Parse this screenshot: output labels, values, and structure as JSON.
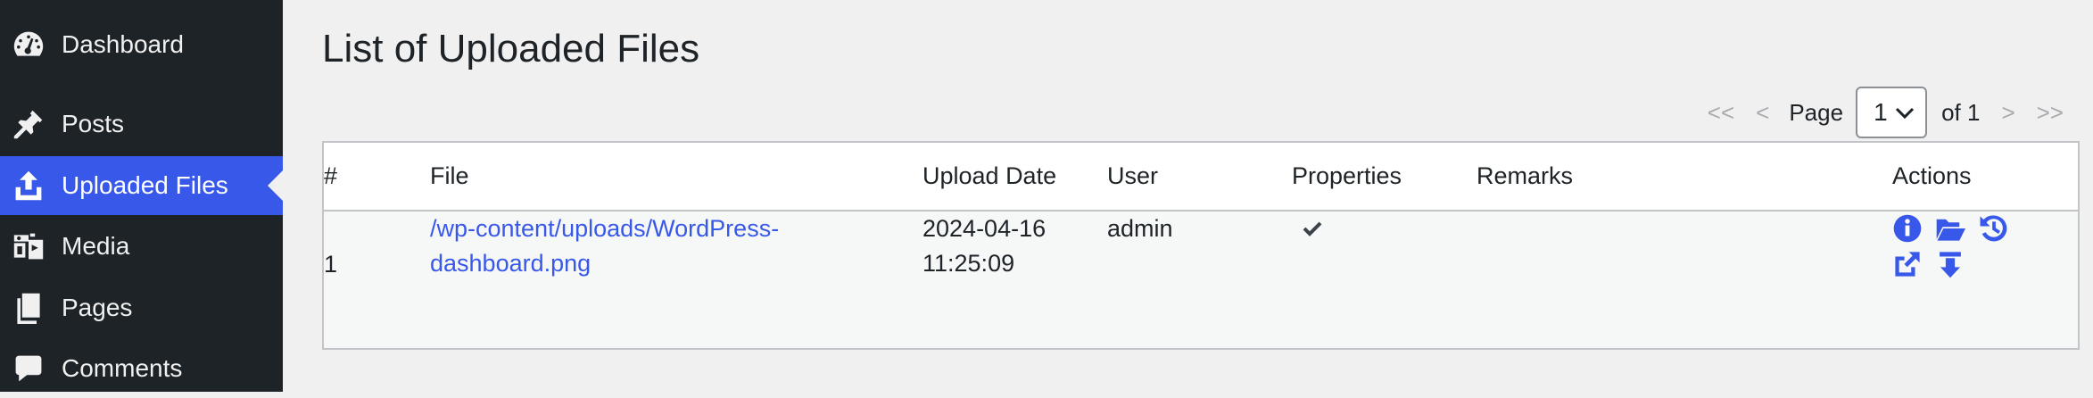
{
  "sidebar": {
    "items": [
      {
        "label": "Dashboard",
        "icon": "dashboard-icon"
      },
      {
        "label": "Posts",
        "icon": "pin-icon"
      },
      {
        "label": "Uploaded Files",
        "icon": "upload-icon",
        "active": true
      },
      {
        "label": "Media",
        "icon": "media-icon"
      },
      {
        "label": "Pages",
        "icon": "pages-icon"
      },
      {
        "label": "Comments",
        "icon": "comment-icon"
      }
    ]
  },
  "main": {
    "title": "List of Uploaded Files",
    "pagination": {
      "first": "<<",
      "prev": "<",
      "page_label": "Page",
      "current": "1",
      "of": "of 1",
      "next": ">",
      "last": ">>"
    },
    "table": {
      "columns": [
        "#",
        "File",
        "Upload Date",
        "User",
        "Properties",
        "Remarks",
        "Actions"
      ],
      "rows": [
        {
          "num": "1",
          "file_line1": "/wp-content/uploads/WordPress-",
          "file_line2": "dashboard.png",
          "date": "2024-04-16",
          "time": "11:25:09",
          "user": "admin",
          "properties_icon": "checkmark-icon",
          "remarks": "",
          "actions": [
            "info-icon",
            "folder-open-icon",
            "history-icon",
            "external-link-icon",
            "download-icon"
          ]
        }
      ]
    }
  },
  "colors": {
    "sidebar_bg": "#1d2327",
    "accent": "#3858e9",
    "page_bg": "#f0f0f1"
  }
}
